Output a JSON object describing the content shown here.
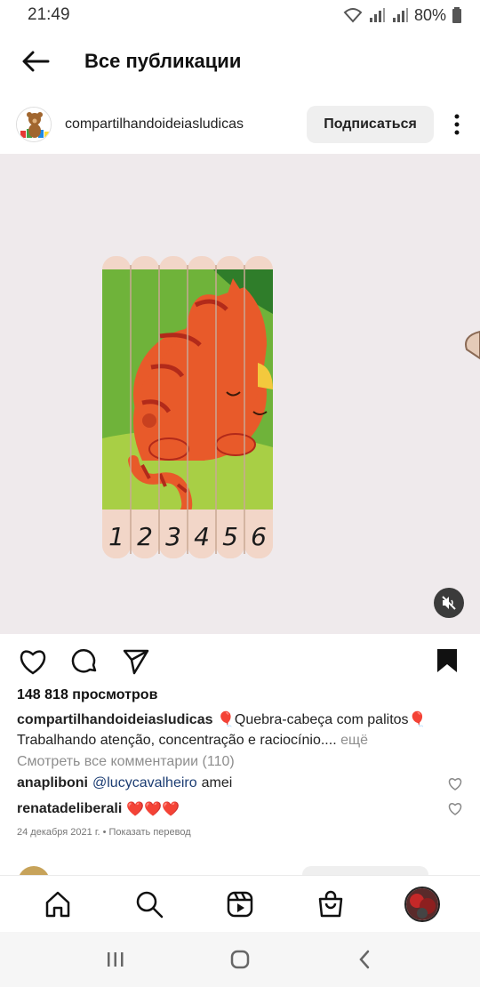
{
  "status_bar": {
    "time": "21:49",
    "battery": "80%"
  },
  "header": {
    "title": "Все публикации",
    "back_icon": "arrow-left-icon"
  },
  "post": {
    "username": "compartilhandoideiasludicas",
    "follow_label": "Подписаться",
    "media": {
      "stick_numbers": [
        "1",
        "2",
        "3",
        "4",
        "5",
        "6"
      ]
    },
    "views": "148 818 просмотров",
    "caption_user": "compartilhandoideiasludicas",
    "caption_text": "🎈Quebra-cabeça com palitos🎈 Trabalhando atenção, concentração e raciocínio.... ",
    "caption_more": "ещё",
    "view_comments": "Смотреть все комментарии (110)",
    "comments": [
      {
        "user": "anapliboni",
        "mention": "@lucycavalheiro",
        "text": "amei"
      },
      {
        "user": "renatadeliberali",
        "mention": "",
        "text": "❤️❤️❤️"
      }
    ],
    "date": "24 декабря 2021 г. • Показать перевод"
  },
  "colors": {
    "accent": "#111111",
    "secondary_text": "#8e8e8e",
    "mention": "#1c3d73",
    "follow_bg": "#efefef"
  }
}
